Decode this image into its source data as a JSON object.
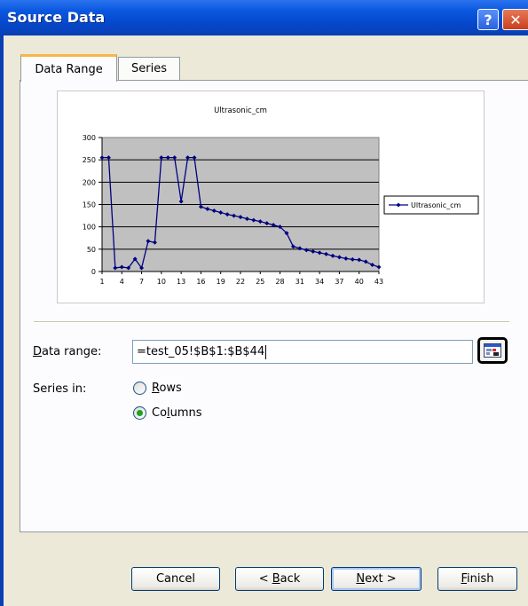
{
  "window": {
    "title": "Source Data"
  },
  "titlebar": {
    "help_glyph": "?",
    "close_glyph": "✕"
  },
  "tabs": [
    {
      "label": "Data Range",
      "active": true
    },
    {
      "label": "Series",
      "active": false
    }
  ],
  "form": {
    "data_range_label_mnemonic": "D",
    "data_range_label_rest": "ata range:",
    "data_range_value": "=test_05!$B$1:$B$44",
    "series_in_label": "Series in:",
    "rows_mnemonic": "R",
    "rows_rest": "ows",
    "columns_pre": "Co",
    "columns_mnemonic": "l",
    "columns_rest": "umns",
    "selected": "columns"
  },
  "buttons": {
    "cancel": "Cancel",
    "back_pre": "< ",
    "back_mnemonic": "B",
    "back_rest": "ack",
    "next_mnemonic": "N",
    "next_rest": "ext >",
    "finish_mnemonic": "F",
    "finish_rest": "inish"
  },
  "colors": {
    "plot_area": "#c0c0c0",
    "series_line": "#000080",
    "title_bar": "#0a58e0"
  },
  "icons": {
    "collapse": "collapse-dialog-icon",
    "help": "help-icon",
    "close": "close-icon"
  },
  "chart_data": {
    "type": "line",
    "title": "Ultrasonic_cm",
    "xlabel": "",
    "ylabel": "",
    "ylim": [
      0,
      300
    ],
    "yticks": [
      0,
      50,
      100,
      150,
      200,
      250,
      300
    ],
    "xtick_labels": [
      "1",
      "4",
      "7",
      "10",
      "13",
      "16",
      "19",
      "22",
      "25",
      "28",
      "31",
      "34",
      "37",
      "40",
      "43"
    ],
    "grid": true,
    "legend": "right",
    "series": [
      {
        "name": "Ultrasonic_cm",
        "x": [
          1,
          2,
          3,
          4,
          5,
          6,
          7,
          8,
          9,
          10,
          11,
          12,
          13,
          14,
          15,
          16,
          17,
          18,
          19,
          20,
          21,
          22,
          23,
          24,
          25,
          26,
          27,
          28,
          29,
          30,
          31,
          32,
          33,
          34,
          35,
          36,
          37,
          38,
          39,
          40,
          41,
          42,
          43
        ],
        "values": [
          255,
          255,
          8,
          10,
          8,
          28,
          8,
          68,
          65,
          255,
          255,
          255,
          157,
          255,
          255,
          145,
          140,
          136,
          132,
          128,
          125,
          122,
          118,
          115,
          112,
          108,
          104,
          100,
          86,
          56,
          52,
          48,
          45,
          42,
          39,
          35,
          32,
          29,
          27,
          26,
          22,
          15,
          10
        ]
      }
    ]
  }
}
